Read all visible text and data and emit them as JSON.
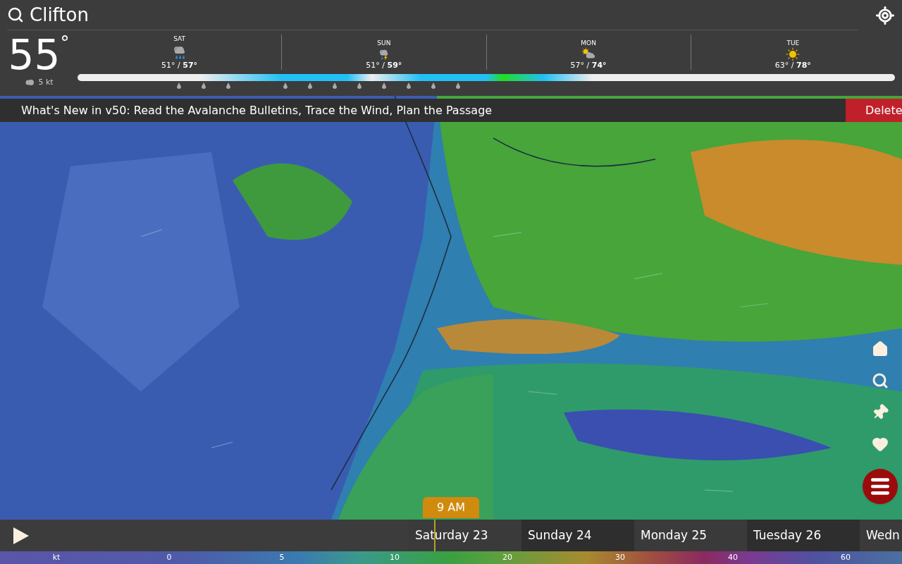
{
  "search": {
    "value": "Clifton"
  },
  "current": {
    "temp": "55",
    "unit": "°",
    "wind": "5 kt"
  },
  "forecast": [
    {
      "day": "SAT",
      "kind": "rain",
      "temps": "51° / **57°**"
    },
    {
      "day": "SUN",
      "kind": "thunder",
      "temps": "51° / **59°**"
    },
    {
      "day": "MON",
      "kind": "partly-sunny",
      "temps": "57° / **74°**"
    },
    {
      "day": "TUE",
      "kind": "sunny",
      "temps": "63° / **78°**"
    }
  ],
  "banner": {
    "text": "What's New in v50: Read the Avalanche Bulletins, Trace the Wind, Plan the Passage",
    "button": "Delete"
  },
  "side_buttons": [
    {
      "kind": "home"
    },
    {
      "kind": "search"
    },
    {
      "kind": "pin"
    },
    {
      "kind": "heart"
    },
    {
      "kind": "menu"
    }
  ],
  "time_bubble": "9 AM",
  "timeline": [
    {
      "label": "Saturday 23",
      "selected": true
    },
    {
      "label": "Sunday 24",
      "selected": false
    },
    {
      "label": "Monday 25",
      "selected": false
    },
    {
      "label": "Tuesday 26",
      "selected": false
    },
    {
      "label": "Wedn",
      "selected": false
    }
  ],
  "legend": {
    "unit": "kt",
    "ticks": [
      "0",
      "5",
      "10",
      "20",
      "30",
      "40",
      "60"
    ]
  }
}
